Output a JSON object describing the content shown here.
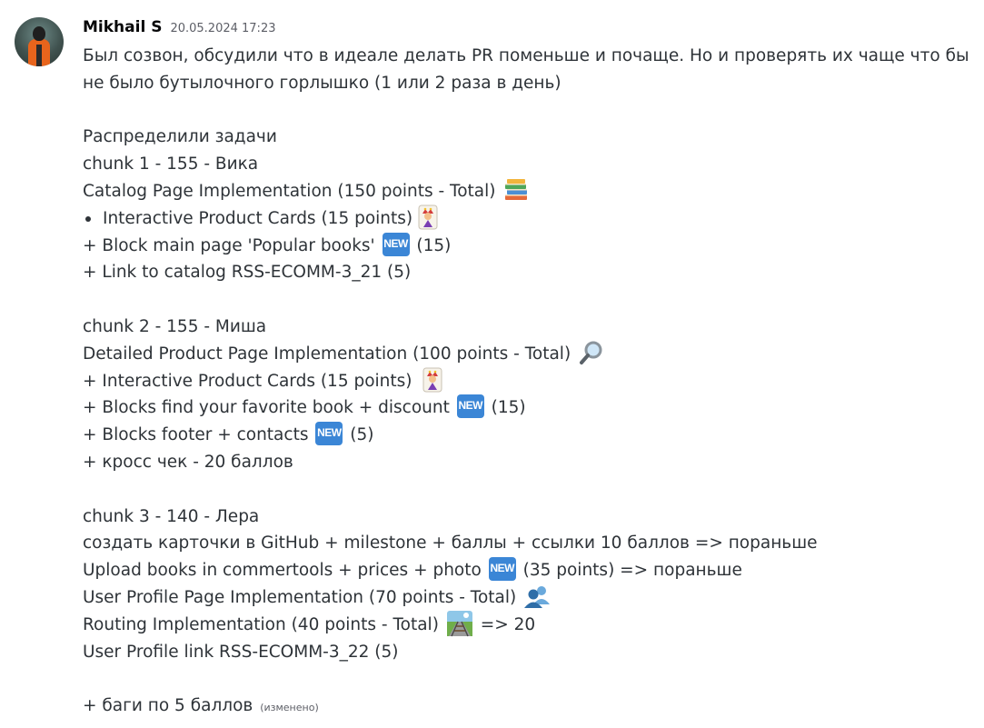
{
  "message": {
    "author": "Mikhail S",
    "timestamp": "20.05.2024 17:23",
    "edited_label": "(изменено)"
  },
  "lines": {
    "l1": "Был созвон, обсудили что в идеале делать  PR поменьше и почаще. Но и проверять их чаще что бы не было бутылочного горлышко (1 или 2 раза в день)",
    "l2": "Распределили задачи",
    "l3": "chunk 1 - 155 - Вика",
    "l4": "Catalog Page Implementation (150 points - Total)",
    "l5": "Interactive Product Cards (15 points)",
    "l6a": "+ Block main page 'Popular books'",
    "l6b": "(15)",
    "l7": "+ Link to catalog RSS-ECOMM-3_21 (5)",
    "l8": "chunk 2 - 155 - Миша",
    "l9": "Detailed Product Page Implementation (100 points - Total)",
    "l10": "+ Interactive Product Cards (15 points)",
    "l11a": "+ Blocks find your favorite book + discount",
    "l11b": "(15)",
    "l12a": "+ Blocks footer + contacts",
    "l12b": "(5)",
    "l13": "+  кросс чек -  20 баллов",
    "l14": "chunk 3 - 140 - Лера",
    "l15": "создать карточки в GitHub + milestone + баллы + ссылки 10 баллов => пораньше",
    "l16a": "Upload books in commertools + prices + photo",
    "l16b": "(35 points) => пораньше",
    "l17": "User Profile Page Implementation (70 points - Total)",
    "l18a": "Routing Implementation (40 points - Total)",
    "l18b": "=> 20",
    "l19": "User Profile link RSS-ECOMM-3_22 (5)",
    "l20": "+ баги по 5 баллов"
  },
  "badges": {
    "new": "NEW"
  },
  "icons": {
    "books": "books-icon",
    "joker": "joker-card-icon",
    "magnifier": "magnifying-glass-icon",
    "users": "busts-in-silhouette-icon",
    "railway": "railway-track-icon"
  },
  "colors": {
    "text": "#2e3338",
    "username": "#060607",
    "timestamp": "#5c5e66",
    "new_badge": "#3b86d6"
  }
}
